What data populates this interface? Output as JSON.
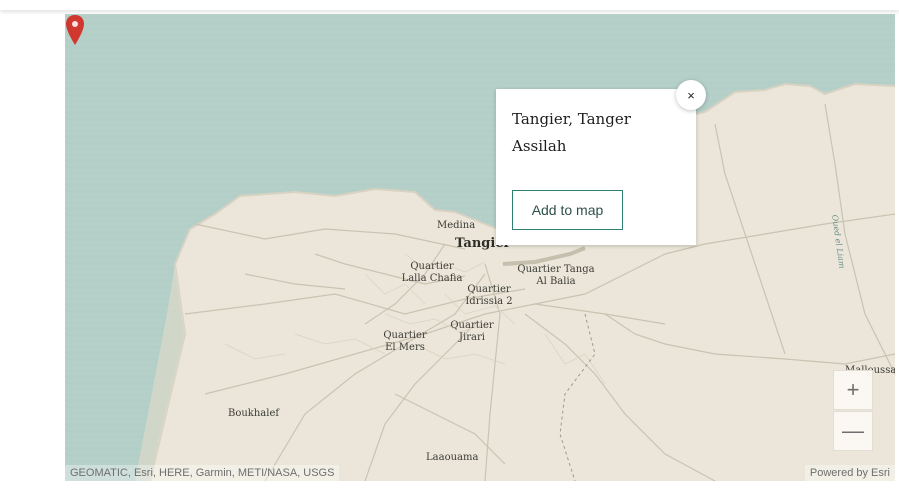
{
  "map": {
    "places": [
      {
        "name": "Medina"
      },
      {
        "name": "Tangier"
      },
      {
        "name": "Quartier Lalla Chafia"
      },
      {
        "name": "Quartier Idrissia 2"
      },
      {
        "name": "Quartier Tanga Al Balia"
      },
      {
        "name": "Quartier Jirari"
      },
      {
        "name": "Quartier El Mers"
      },
      {
        "name": "Boukhalef"
      },
      {
        "name": "Laaouama"
      },
      {
        "name": "Malloussa"
      },
      {
        "name": "Oued el Liam"
      }
    ],
    "attribution_left": "GEOMATIC, Esri, HERE, Garmin, METI/NASA, USGS",
    "attribution_right": "Powered by Esri",
    "zoom_in_icon": "+",
    "zoom_out_icon": "—"
  },
  "popup": {
    "title": "Tangier, Tanger Assilah",
    "button_label": "Add to map",
    "close_icon": "×"
  },
  "colors": {
    "water": "#b5d0c9",
    "land": "#ebe6d9",
    "roads": "#c9c3b2",
    "pin": "#d0372e",
    "button_border": "#2f7f73"
  }
}
